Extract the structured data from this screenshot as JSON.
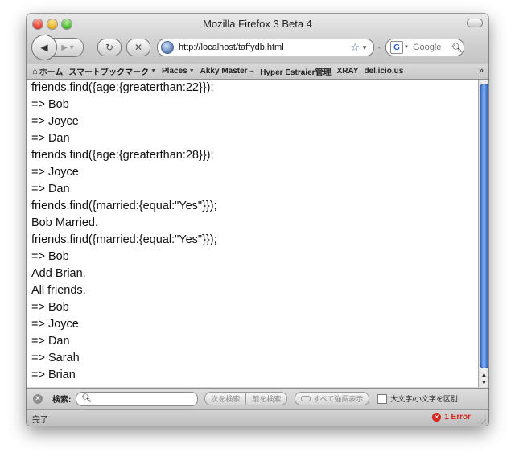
{
  "window": {
    "title": "Mozilla Firefox 3 Beta 4"
  },
  "toolbar": {
    "url": "http://localhost/taffydb.html",
    "search_placeholder": "Google",
    "search_engine_letter": "G",
    "icons": {
      "back": "back-arrow-icon",
      "forward": "forward-arrow-icon",
      "reload": "reload-icon",
      "stop": "stop-icon",
      "site": "site-identity-icon",
      "bookmark": "star-icon"
    }
  },
  "bookmarks": [
    {
      "label": "ホーム"
    },
    {
      "label": "スマートブックマーク"
    },
    {
      "label": "Places"
    },
    {
      "label": "Akky Master"
    },
    {
      "label": "Hyper Estraier管理"
    },
    {
      "label": "XRAY"
    },
    {
      "label": "del.icio.us"
    }
  ],
  "content": {
    "lines": [
      "friends.find({age:{greaterthan:22}});",
      "=> Bob",
      "=> Joyce",
      "=> Dan",
      "friends.find({age:{greaterthan:28}});",
      "=> Joyce",
      "=> Dan",
      "friends.find({married:{equal:\"Yes\"}});",
      "Bob Married.",
      "friends.find({married:{equal:\"Yes\"}});",
      "=> Bob",
      "Add Brian.",
      "All friends.",
      "=> Bob",
      "=> Joyce",
      "=> Dan",
      "=> Sarah",
      "=> Brian"
    ]
  },
  "findbar": {
    "label": "検索:",
    "next_label": "次を検索",
    "prev_label": "前を検索",
    "highlight_label": "すべて強調表示",
    "match_case_label": "大文字/小文字を区別"
  },
  "statusbar": {
    "status": "完了",
    "error_text": "1 Error",
    "error_color": "#d9251d"
  }
}
